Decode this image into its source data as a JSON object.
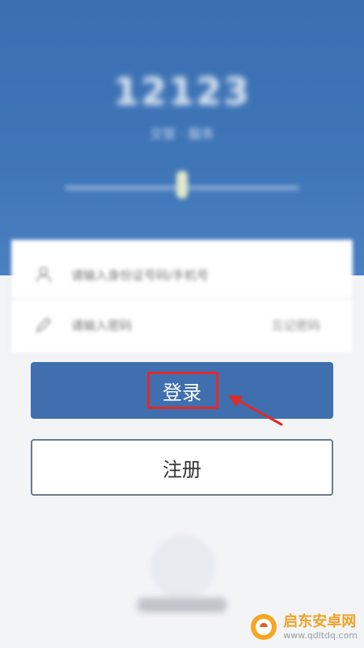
{
  "header": {
    "brand": "12123",
    "subtitle": "交管 · 服务"
  },
  "form": {
    "account": {
      "icon": "user-icon",
      "placeholder": "请输入身份证号码/手机号"
    },
    "password": {
      "icon": "pencil-icon",
      "placeholder": "请输入密码",
      "right_link": "忘记密码"
    }
  },
  "buttons": {
    "login_label": "登录",
    "register_label": "注册"
  },
  "colors": {
    "header_blue": "#3f76b8",
    "login_button": "#3f6fae",
    "annotation_red": "#e12a2a",
    "watermark_orange": "#f0a227"
  },
  "watermark": {
    "name": "启东安卓网",
    "url": "www.qdltdq.com"
  }
}
